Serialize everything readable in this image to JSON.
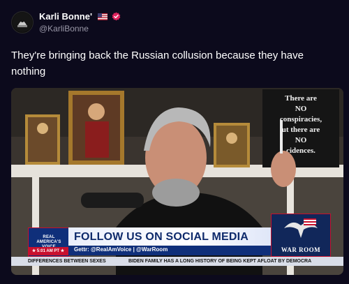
{
  "post": {
    "display_name": "Karli Bonne'",
    "handle": "@KarliBonne",
    "text": "They're bringing back the Russian collusion because they have nothing"
  },
  "media": {
    "sign_text": [
      "There are",
      "NO",
      "conspiracies,",
      "ut there are",
      "NO",
      "cidences."
    ],
    "lower_third": {
      "network_logo_lines": [
        "REAL",
        "AMERICA'S",
        "VOICE"
      ],
      "headline": "FOLLOW US ON SOCIAL MEDIA",
      "subline": "Gettr: @RealAmVoice | @WarRoom",
      "time": "★ 5:01 AM PT ★",
      "show_logo": "WAR ROOM",
      "ticker_left": "DIFFERENCES BETWEEN SEXES",
      "ticker_right": "BIDEN FAMILY HAS A LONG HISTORY OF BEING KEPT AFLOAT BY DEMOCRA"
    }
  },
  "colors": {
    "background": "#0c0a1c",
    "verified_badge": "#e0245e",
    "network_blue": "#0f2f7a",
    "network_red": "#c8102e"
  },
  "icons": [
    "avatar",
    "us-flag-icon",
    "verified-badge-icon",
    "eagle-icon"
  ]
}
